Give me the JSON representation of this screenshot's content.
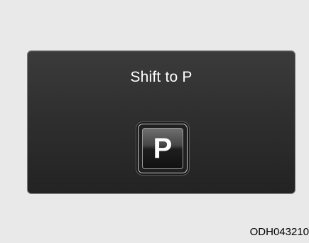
{
  "display": {
    "message": "Shift to P",
    "gear_indicator": "P"
  },
  "figure": {
    "code": "ODH043210"
  }
}
